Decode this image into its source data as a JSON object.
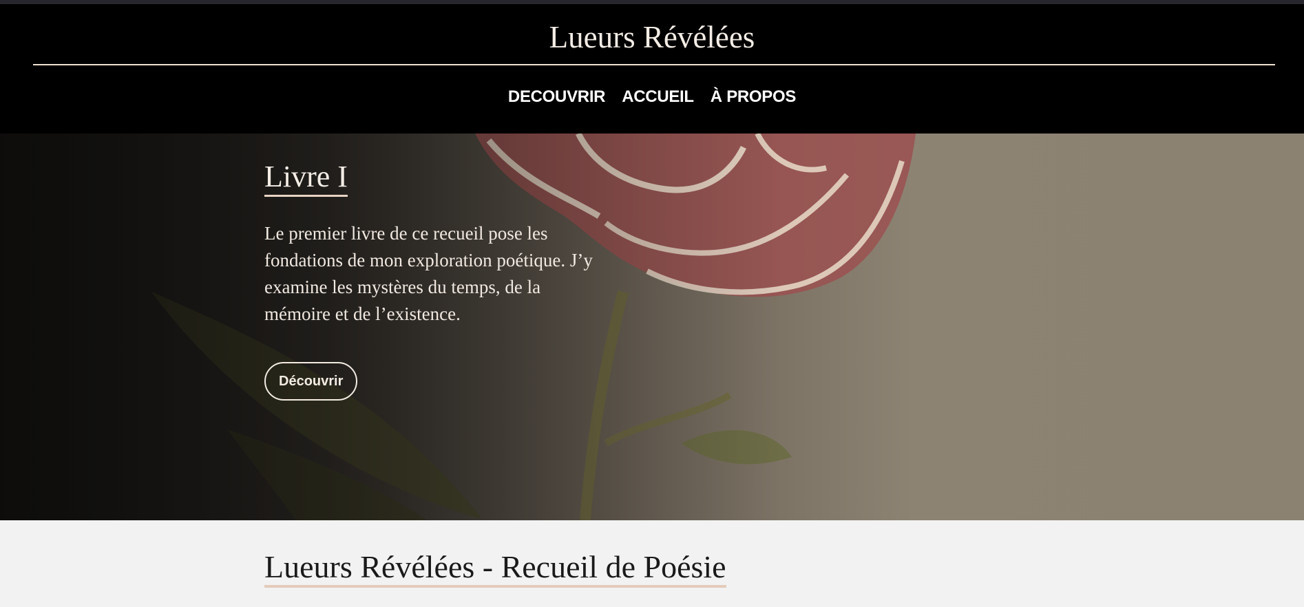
{
  "site": {
    "title": "Lueurs Révélées"
  },
  "nav": {
    "items": [
      "DECOUVRIR",
      "ACCUEIL",
      "À PROPOS"
    ]
  },
  "hero": {
    "title": "Livre I",
    "text": "Le premier livre de ce recueil pose les fondations de mon exploration poétique. J’y examine les mystères du temps, de la mémoire et de l’existence.",
    "button": "Découvrir",
    "background_image": "watercolor-rose-on-paper"
  },
  "section": {
    "title": "Lueurs Révélées - Recueil de Poésie"
  },
  "colors": {
    "header_bg": "#000000",
    "accent_underline": "#e5cbbb",
    "page_bg": "#f2f2f2"
  }
}
